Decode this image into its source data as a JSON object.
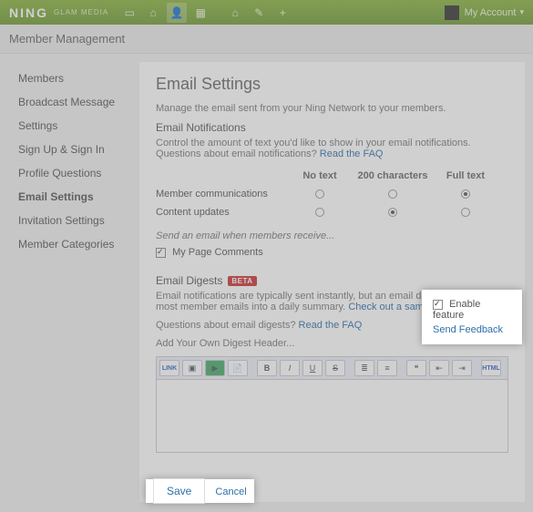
{
  "topbar": {
    "brand": "NING",
    "brand_sub": "GLAM MEDIA",
    "icons": [
      "screen-icon",
      "person-icon",
      "user-icon",
      "grid-icon",
      "home-icon",
      "wrench-icon",
      "plus-icon"
    ],
    "account_label": "My Account"
  },
  "subbar": {
    "title": "Member Management"
  },
  "sidebar": {
    "items": [
      {
        "label": "Members"
      },
      {
        "label": "Broadcast Message"
      },
      {
        "label": "Settings"
      },
      {
        "label": "Sign Up & Sign In"
      },
      {
        "label": "Profile Questions"
      },
      {
        "label": "Email Settings"
      },
      {
        "label": "Invitation Settings"
      },
      {
        "label": "Member Categories"
      }
    ],
    "activeIndex": 5
  },
  "main": {
    "title": "Email Settings",
    "intro": "Manage the email sent from your Ning Network to your members.",
    "notifications": {
      "heading": "Email Notifications",
      "desc_prefix": "Control the amount of text you'd like to show in your email notifications. Questions about email notifications? ",
      "faq_link": "Read the FAQ",
      "columns": [
        "No text",
        "200 characters",
        "Full text"
      ],
      "rows": [
        {
          "label": "Member communications",
          "selected": 2
        },
        {
          "label": "Content updates",
          "selected": 1
        }
      ],
      "when_receive": "Send an email when members receive...",
      "checkbox_label": "My Page Comments",
      "checkbox_checked": true
    },
    "digests": {
      "heading": "Email Digests",
      "badge": "BETA",
      "desc_prefix": "Email notifications are typically sent instantly, but an email digest combines most member emails into a daily summary. ",
      "sample_link": "Check out a sample digest",
      "desc_q_prefix": "Questions about email digests? ",
      "faq_link": "Read the FAQ",
      "header_label": "Add Your Own Digest Header...",
      "toolbar": [
        "LINK",
        "img-icon",
        "media-icon",
        "file-icon",
        "B",
        "I",
        "U",
        "S",
        "list-ul",
        "list-ol",
        "quote",
        "outdent",
        "indent",
        "HTML"
      ]
    },
    "buttons": {
      "save": "Save",
      "cancel": "Cancel"
    }
  },
  "highlight": {
    "enable_label": "Enable feature",
    "enable_checked": true,
    "feedback_link": "Send Feedback"
  }
}
